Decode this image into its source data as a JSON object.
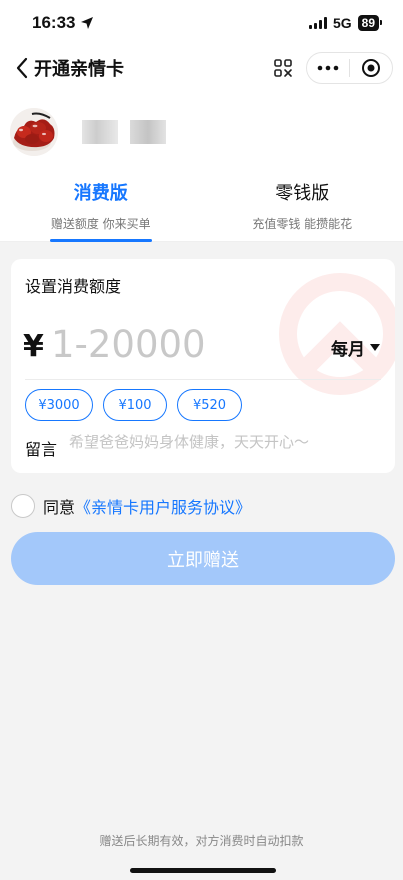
{
  "status_bar": {
    "time": "16:33",
    "network": "5G",
    "battery": "89",
    "icons": [
      "location-arrow-icon",
      "signal-icon"
    ]
  },
  "nav": {
    "title": "开通亲情卡",
    "icons": [
      "back-chevron-icon",
      "scan-icon",
      "more-dots-icon",
      "target-close-icon"
    ]
  },
  "user": {
    "avatar_icon": "jujube-avatar"
  },
  "tabs": [
    {
      "title": "消费版",
      "subtitle": "赠送额度 你来买单",
      "active": true
    },
    {
      "title": "零钱版",
      "subtitle": "充值零钱 能攒能花",
      "active": false
    }
  ],
  "quota_card": {
    "title": "设置消费额度",
    "currency": "¥",
    "amount_placeholder": "1-20000",
    "amount_value": "",
    "period": "每月",
    "chips": [
      "¥3000",
      "¥100",
      "¥520"
    ],
    "message_label": "留言",
    "message_placeholder": "希望爸爸妈妈身体健康，天天开心～"
  },
  "agreement": {
    "prefix": "同意",
    "link": "《亲情卡用户服务协议》",
    "checked": false
  },
  "submit_label": "立即赠送",
  "footer_note": "赠送后长期有效，对方消费时自动扣款",
  "colors": {
    "accent": "#1677ff",
    "button_disabled": "#a3c8fa",
    "page_bg": "#f3f3f3",
    "card_bg": "#ffffff"
  }
}
